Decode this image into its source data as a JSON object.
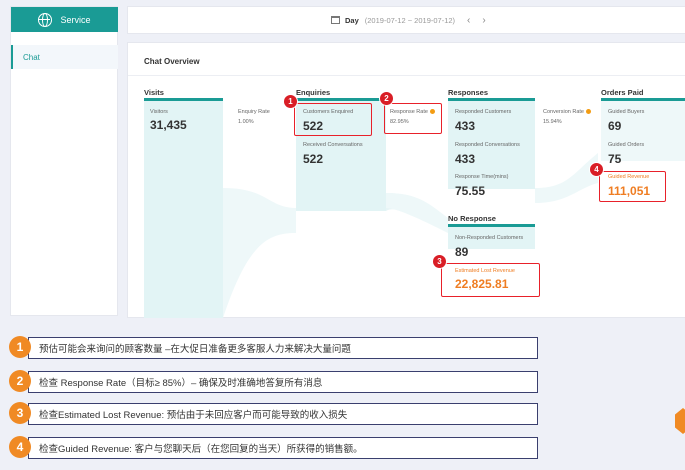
{
  "sidebar": {
    "service_label": "Service",
    "chat_label": "Chat"
  },
  "datebar": {
    "period": "Day",
    "range": "(2019-07-12 ~ 2019-07-12)",
    "prev": "‹",
    "next": "›"
  },
  "overview": {
    "title": "Chat Overview",
    "visits": {
      "title": "Visits",
      "visitors_label": "Visitors",
      "visitors": "31,435"
    },
    "enquiry_rate": {
      "label": "Enquiry Rate",
      "value": "1.00%"
    },
    "enquiries": {
      "title": "Enquiries",
      "customers_label": "Customers Enquired",
      "customers": "522",
      "conversations_label": "Received Conversations",
      "conversations": "522"
    },
    "response_rate": {
      "label": "Response Rate",
      "value": "82.95%"
    },
    "responses": {
      "title": "Responses",
      "customers_label": "Responded Customers",
      "customers": "433",
      "conversations_label": "Responded Conversations",
      "conversations": "433",
      "time_label": "Response Time(mins)",
      "time": "75.55"
    },
    "conversion_rate": {
      "label": "Conversion Rate",
      "value": "15.94%"
    },
    "orders": {
      "title": "Orders Paid",
      "buyers_label": "Guided Buyers",
      "buyers": "69",
      "orders_label": "Guided Orders",
      "orders": "75",
      "revenue_label": "Guided Revenue",
      "revenue": "111,051"
    },
    "no_response": {
      "title": "No Response",
      "customers_label": "Non-Responded Customers",
      "customers": "89",
      "lost_label": "Estimated Lost Revenue",
      "lost": "22,825.81"
    }
  },
  "badges": [
    "1",
    "2",
    "3",
    "4"
  ],
  "notes": [
    {
      "num": "1",
      "text": "预估可能会来询问的顾客数量 –在大促日准备更多客服人力来解决大量问题"
    },
    {
      "num": "2",
      "text": "检查 Response Rate（目标≥ 85%）– 确保及时准确地答复所有消息"
    },
    {
      "num": "3",
      "text": "检查Estimated Lost Revenue: 预估由于未回应客户而可能导致的收入损失"
    },
    {
      "num": "4",
      "text": "检查Guided Revenue: 客户与您聊天后（在您回复的当天）所获得的销售额。"
    }
  ],
  "colors": {
    "teal": "#1a9b95",
    "light_teal": "#e2f4f5",
    "highlight_red": "#e8212a",
    "orange": "#f08a24"
  }
}
